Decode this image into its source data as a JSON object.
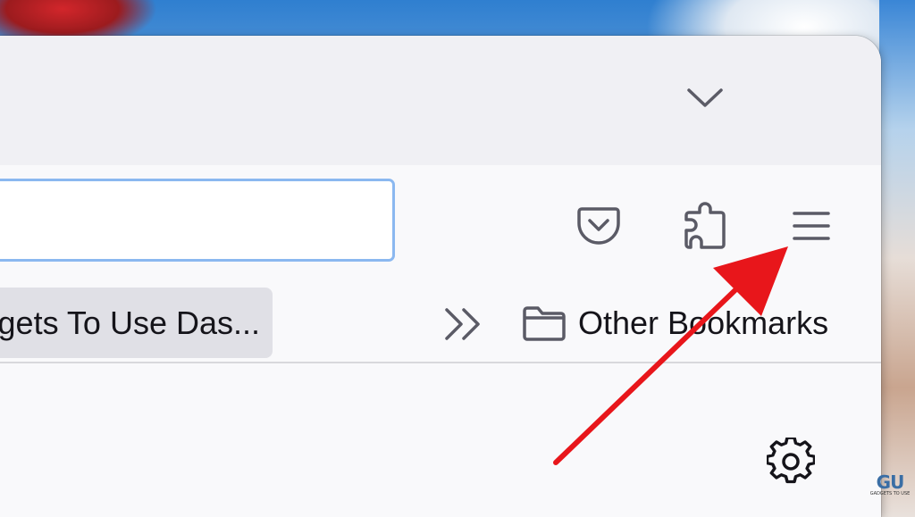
{
  "toolbar": {
    "url_value": "",
    "pocket_icon": "pocket-icon",
    "extensions_icon": "puzzle-piece-icon",
    "menu_icon": "hamburger-menu-icon",
    "tab_list_icon": "chevron-down-icon"
  },
  "bookmarks_bar": {
    "items": [
      {
        "label": "gets To Use Das..."
      }
    ],
    "overflow_icon": "double-chevron-right-icon",
    "other_bookmarks": {
      "icon": "folder-icon",
      "label": "Other Bookmarks"
    }
  },
  "content": {
    "settings_icon": "gear-icon"
  },
  "annotation": {
    "arrow_color": "#e8161b",
    "target": "hamburger-menu"
  },
  "watermark": {
    "logo": "GU",
    "tagline": "GADGETS TO USE"
  },
  "colors": {
    "tabstrip": "#f0f0f4",
    "toolbar": "#f9f9fb",
    "urlbar_focus": "#8bb8f0",
    "bookmark_hover": "#e0e0e6",
    "icon": "#5b5b66"
  }
}
